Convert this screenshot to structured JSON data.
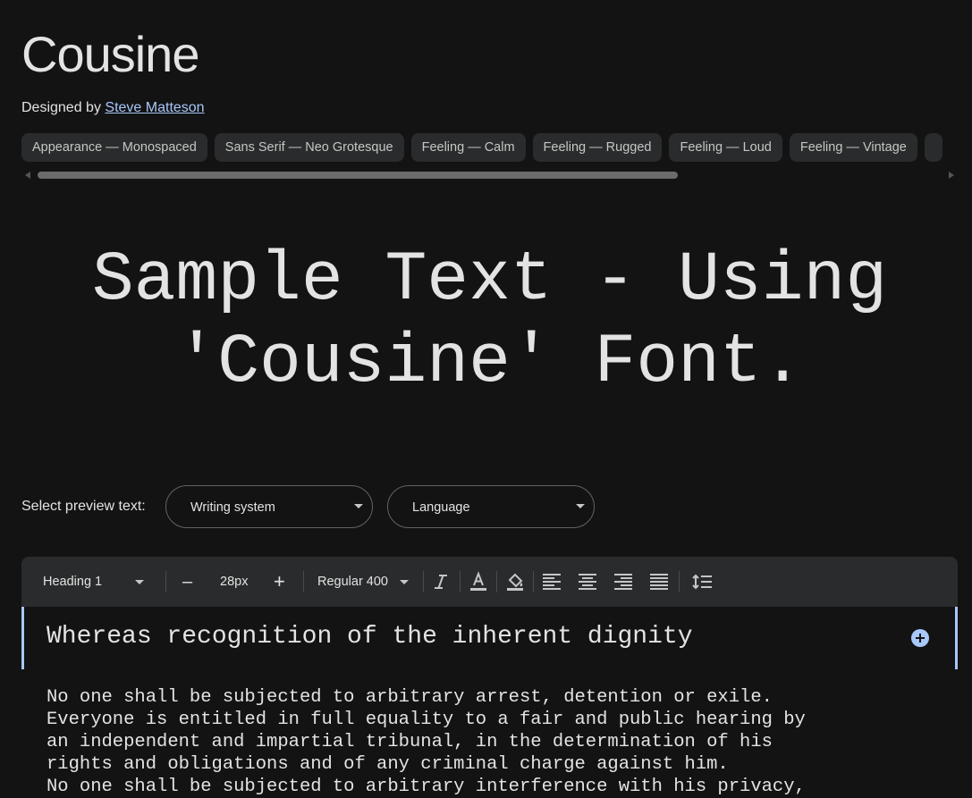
{
  "font": {
    "name": "Cousine",
    "designed_by_label": "Designed by",
    "designer": "Steve Matteson"
  },
  "tags": [
    "Appearance — Monospaced",
    "Sans Serif — Neo Grotesque",
    "Feeling — Calm",
    "Feeling — Rugged",
    "Feeling — Loud",
    "Feeling — Vintage"
  ],
  "sample": {
    "line1": "Sample Text - Using",
    "line2": "'Cousine' Font."
  },
  "preview": {
    "label": "Select preview text:",
    "writing_system": "Writing system",
    "language": "Language"
  },
  "toolbar": {
    "style": "Heading 1",
    "decrease": "–",
    "size": "28px",
    "increase": "+",
    "weight": "Regular 400"
  },
  "editor": {
    "heading": "Whereas recognition of the inherent dignity",
    "body_lines": [
      "No one shall be subjected to arbitrary arrest, detention or exile.",
      "Everyone is entitled in full equality to a fair and public hearing by",
      "an independent and impartial tribunal, in the determination of his",
      "rights and obligations and of any criminal charge against him.",
      "No one shall be subjected to arbitrary interference with his privacy,"
    ]
  },
  "colors": {
    "background": "#131314",
    "accent": "#a8c7fa",
    "chip": "#2a2b2c"
  },
  "icons": [
    "italic-icon",
    "text-color-icon",
    "highlight-icon",
    "align-left-icon",
    "align-center-icon",
    "align-right-icon",
    "align-justify-icon",
    "line-height-icon",
    "add-circle-icon"
  ]
}
